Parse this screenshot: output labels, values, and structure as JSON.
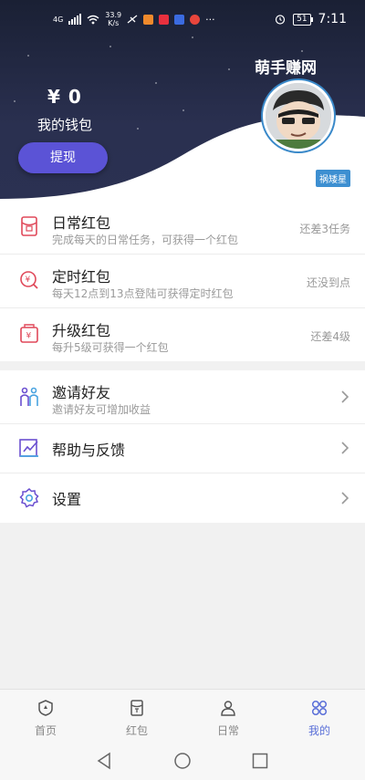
{
  "status_bar": {
    "network": "4G",
    "speed_value": "33.9",
    "speed_unit": "K/s",
    "battery": "51",
    "time": "7:11"
  },
  "wallet": {
    "amount": "¥ 0",
    "label": "我的钱包",
    "withdraw_button": "提现"
  },
  "profile": {
    "site_name": "萌手赚网",
    "badge": "祸矮星"
  },
  "red_packets": [
    {
      "title": "日常红包",
      "subtitle": "完成每天的日常任务，可获得一个红包",
      "status": "还差3任务",
      "icon": "daily-packet-icon"
    },
    {
      "title": "定时红包",
      "subtitle": "每天12点到13点登陆可获得定时红包",
      "status": "还没到点",
      "icon": "timed-packet-icon"
    },
    {
      "title": "升级红包",
      "subtitle": "每升5级可获得一个红包",
      "status": "还差4级",
      "icon": "upgrade-packet-icon"
    }
  ],
  "menu": [
    {
      "title": "邀请好友",
      "subtitle": "邀请好友可增加收益",
      "icon": "invite-friends-icon"
    },
    {
      "title": "帮助与反馈",
      "icon": "help-feedback-icon"
    },
    {
      "title": "设置",
      "icon": "settings-icon"
    }
  ],
  "tabs": [
    {
      "label": "首页",
      "icon": "home-icon",
      "active": false
    },
    {
      "label": "红包",
      "icon": "red-packet-icon",
      "active": false
    },
    {
      "label": "日常",
      "icon": "daily-icon",
      "active": false
    },
    {
      "label": "我的",
      "icon": "me-icon",
      "active": true
    }
  ],
  "colors": {
    "header_bg": "#1e2440",
    "accent_button": "#5b53d6",
    "active_tab": "#5a6fd8",
    "red_icon": "#e0495a",
    "purple_icon": "#6a4fd0"
  }
}
